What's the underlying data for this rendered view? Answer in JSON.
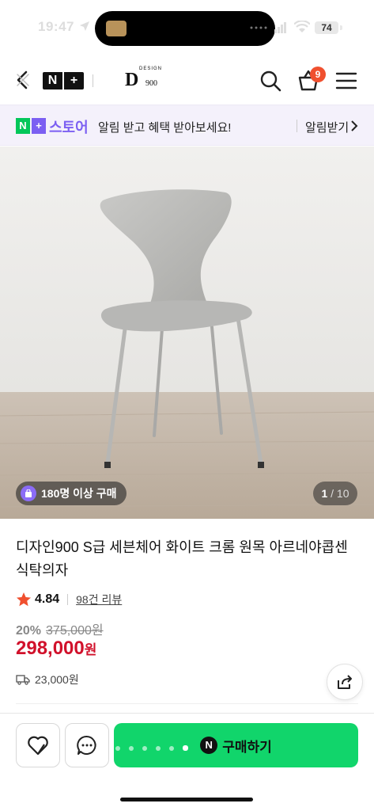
{
  "status_bar": {
    "time": "19:47",
    "battery": "74"
  },
  "header": {
    "logo_n": "N",
    "logo_plus": "+",
    "brand_mark": "D",
    "brand_design": "DESIGN",
    "brand_number": "900",
    "cart_count": "9"
  },
  "store_banner": {
    "badge_n": "N",
    "badge_plus": "+",
    "store_label": "스토어",
    "message": "알림 받고 혜택 받아보세요!",
    "action_label": "알림받기"
  },
  "product_image": {
    "purchase_badge": "180명 이상 구매",
    "current_page": "1",
    "total_pages": "/ 10",
    "carousel_pages": 10,
    "carousel_current": 1
  },
  "product": {
    "title": "디자인900 S급 세븐체어 화이트 크롬 원목 아르네야콥센 식탁의자",
    "rating": "4.84",
    "review_count": "98건 리뷰",
    "discount_rate": "20%",
    "original_price": "375,000원",
    "sale_price": "298,000",
    "sale_price_unit": "원",
    "shipping_fee": "23,000원"
  },
  "bottom_bar": {
    "buy_n": "N",
    "buy_label": "구매하기"
  },
  "colors": {
    "accent_green": "#11d56b",
    "naver_green": "#03c75a",
    "store_purple": "#7b5ff2",
    "price_red": "#d1112b",
    "badge_orange": "#f0502f",
    "star": "#f0502f"
  }
}
